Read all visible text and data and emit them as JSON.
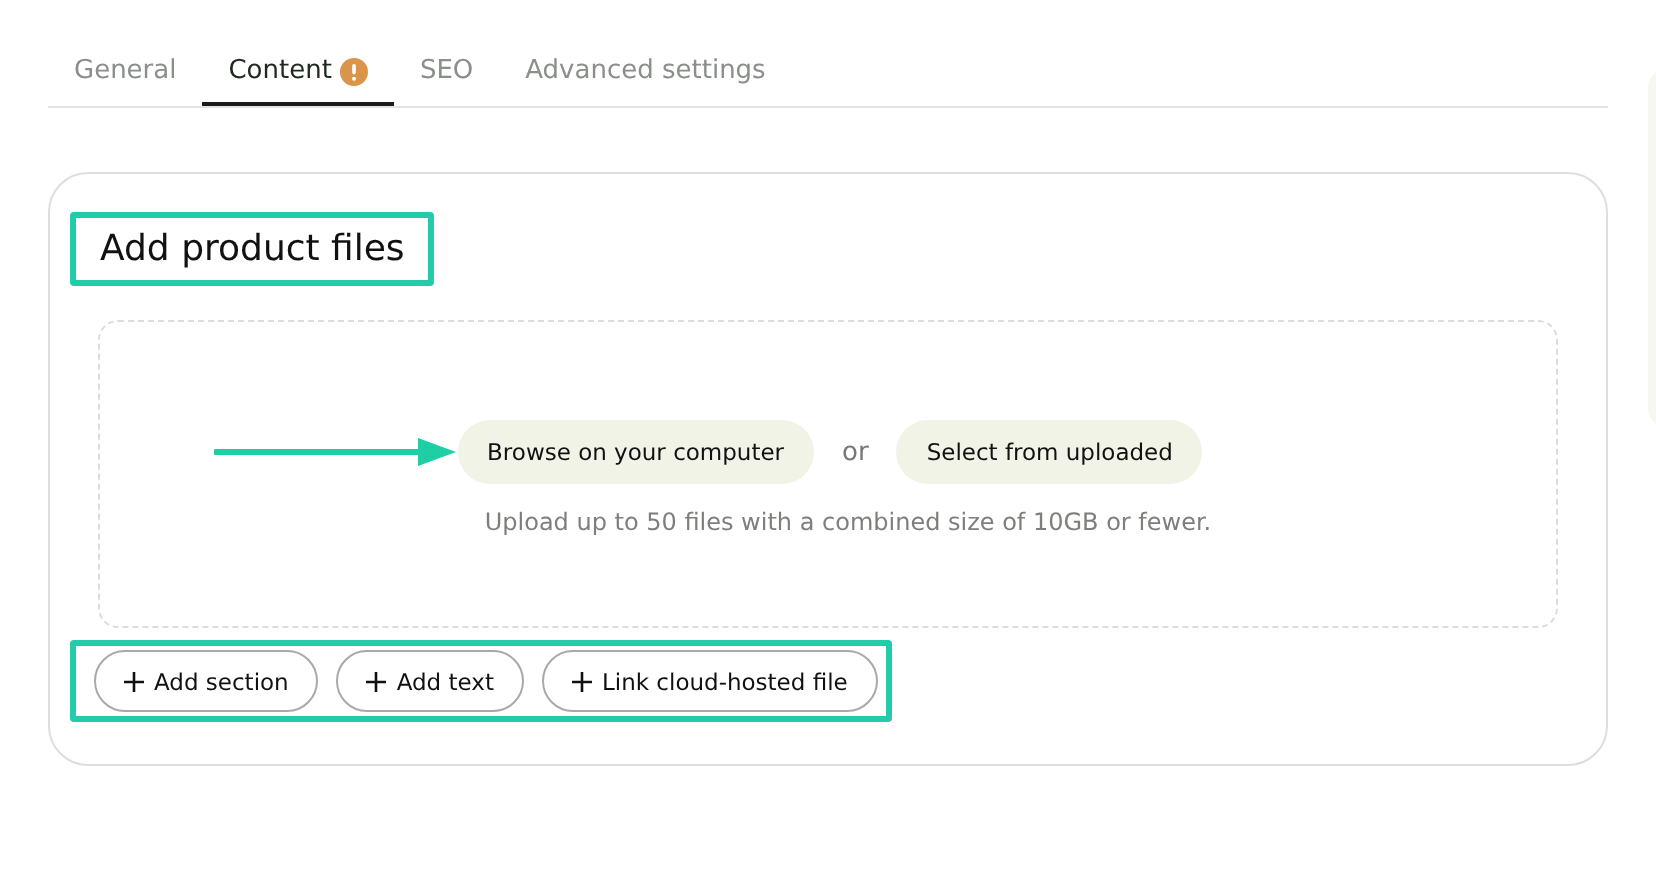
{
  "tabs": [
    {
      "label": "General",
      "selected": false,
      "warning": false
    },
    {
      "label": "Content",
      "selected": true,
      "warning": true
    },
    {
      "label": "SEO",
      "selected": false,
      "warning": false
    },
    {
      "label": "Advanced settings",
      "selected": false,
      "warning": false
    }
  ],
  "card": {
    "title": "Add product files",
    "title_highlighted": true,
    "upload": {
      "browse_button": "Browse on your computer",
      "or": "or",
      "select_button": "Select from uploaded",
      "hint": "Upload up to 50 files with a combined size of 10GB or fewer.",
      "arrow": true
    },
    "actions_highlighted": true,
    "actions": [
      {
        "label": "Add section"
      },
      {
        "label": "Add text"
      },
      {
        "label": "Link cloud-hosted file"
      }
    ]
  }
}
